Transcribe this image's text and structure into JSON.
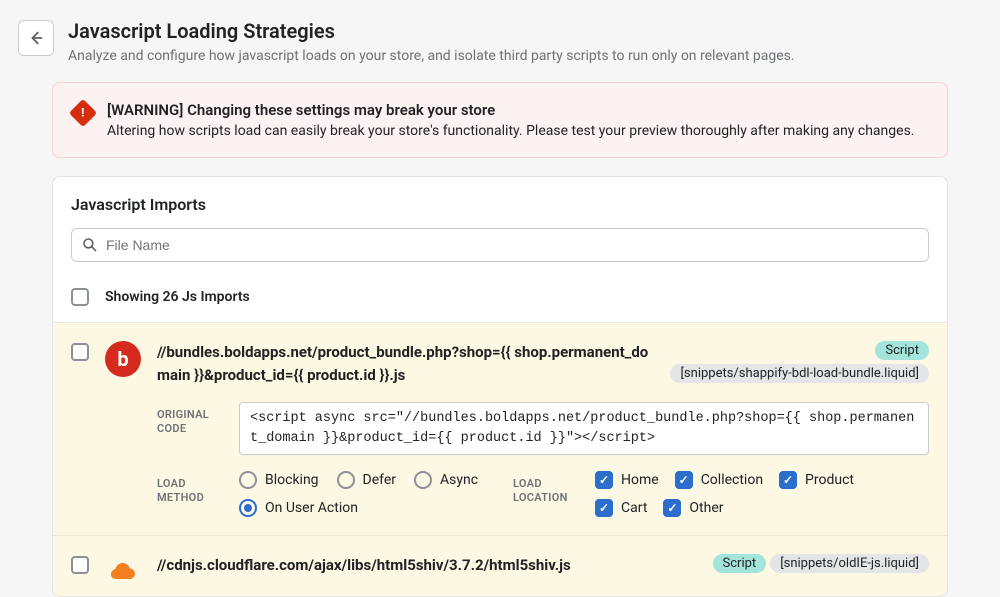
{
  "header": {
    "title": "Javascript Loading Strategies",
    "subtitle": "Analyze and configure how javascript loads on your store, and isolate third party scripts to run only on relevant pages."
  },
  "warning": {
    "title": "[WARNING] Changing these settings may break your store",
    "body": "Altering how scripts load can easily break your store's functionality. Please test your preview thoroughly after making any changes."
  },
  "imports": {
    "section_title": "Javascript Imports",
    "search_placeholder": "File Name",
    "showing_text": "Showing 26 Js Imports",
    "labels": {
      "original_code": "ORIGINAL CODE",
      "load_method": "LOAD METHOD",
      "load_location": "LOAD LOCATION"
    },
    "method_options": [
      "Blocking",
      "Defer",
      "Async",
      "On User Action"
    ],
    "location_options": [
      "Home",
      "Collection",
      "Product",
      "Cart",
      "Other"
    ],
    "rows": [
      {
        "url": "//bundles.boldapps.net/product_bundle.php?shop={{ shop.permanent_domain }}&product_id={{ product.id }}.js",
        "type_badge": "Script",
        "path_badge": "[snippets/shappify-bdl-load-bundle.liquid]",
        "code": "<script async src=\"//bundles.boldapps.net/product_bundle.php?shop={{ shop.permanent_domain }}&product_id={{ product.id }}\"></script>",
        "method_selected": "On User Action",
        "locations_checked": [
          "Home",
          "Collection",
          "Product",
          "Cart",
          "Other"
        ],
        "logo_letter": "b"
      },
      {
        "url": "//cdnjs.cloudflare.com/ajax/libs/html5shiv/3.7.2/html5shiv.js",
        "type_badge": "Script",
        "path_badge": "[snippets/oldIE-js.liquid]"
      }
    ]
  }
}
